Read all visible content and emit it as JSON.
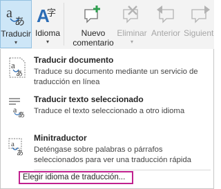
{
  "ribbon": {
    "translate_label": "Traducir",
    "language_label": "Idioma",
    "new_comment_label_1": "Nuevo",
    "new_comment_label_2": "comentario",
    "delete_label": "Eliminar",
    "previous_label": "Anterior",
    "next_label": "Siguiente",
    "dropdown_glyph": "▾"
  },
  "menu": {
    "items": [
      {
        "title": "Traducir documento",
        "description": "Traduce su documento mediante un servicio de traducción en línea",
        "icon": "translate-document-icon"
      },
      {
        "title": "Traducir texto seleccionado",
        "description": "Traduce el texto seleccionado a otro idioma",
        "icon": "translate-selected-text-icon"
      },
      {
        "title": "Minitraductor",
        "description": "Deténgase sobre palabras o párrafos seleccionados para ver una traducción rápida",
        "icon": "mini-translator-icon"
      }
    ],
    "choose_language": "Elegir idioma de traducción..."
  },
  "colors": {
    "highlight_border": "#c0208e",
    "active_button_bg": "#cde6f7",
    "accent_green": "#2e9e4f",
    "accent_blue": "#2b6cb5"
  }
}
